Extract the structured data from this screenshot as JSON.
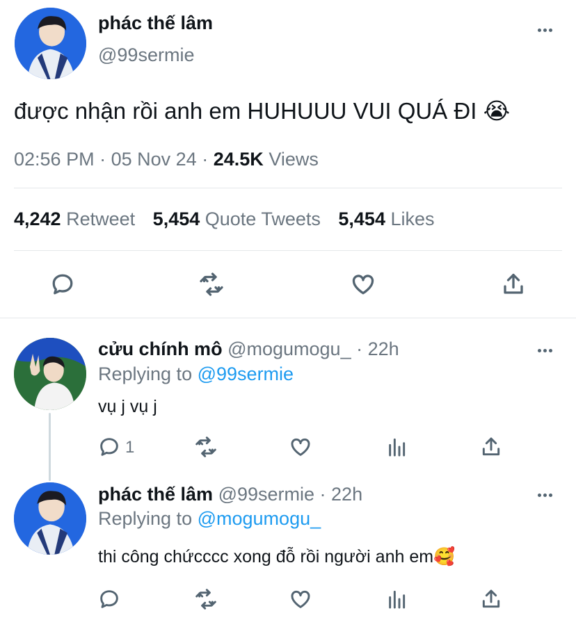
{
  "main_tweet": {
    "display_name": "phác thế lâm",
    "handle": "@99sermie",
    "text": "được nhận rồi anh em HUHUUU VUI QUÁ ĐI 😭",
    "time": "02:56 PM",
    "date": "05 Nov 24",
    "separator": "·",
    "views_count": "24.5K",
    "views_label": "Views",
    "stats": {
      "retweets_count": "4,242",
      "retweets_label": "Retweet",
      "quotes_count": "5,454",
      "quotes_label": "Quote Tweets",
      "likes_count": "5,454",
      "likes_label": "Likes"
    }
  },
  "replies": [
    {
      "display_name": "cửu chính mô",
      "handle": "@mogumogu_",
      "time": "· 22h",
      "replying_prefix": "Replying to",
      "replying_to": "@99sermie",
      "text": "vụ j vụ j",
      "reply_count": "1"
    },
    {
      "display_name": "phác thế lâm",
      "handle": "@99sermie",
      "time": "· 22h",
      "replying_prefix": "Replying to",
      "replying_to": "@mogumogu_",
      "text": "thi công chứcccc xong đỗ rồi người anh em🥰",
      "reply_count": ""
    }
  ],
  "icons": [
    "more-icon",
    "reply-icon",
    "retweet-icon",
    "like-icon",
    "share-icon",
    "analytics-icon"
  ],
  "colors": {
    "link": "#1d9bf0",
    "muted": "#6b7680",
    "text": "#0f1419",
    "divider": "#e4e7ea"
  }
}
